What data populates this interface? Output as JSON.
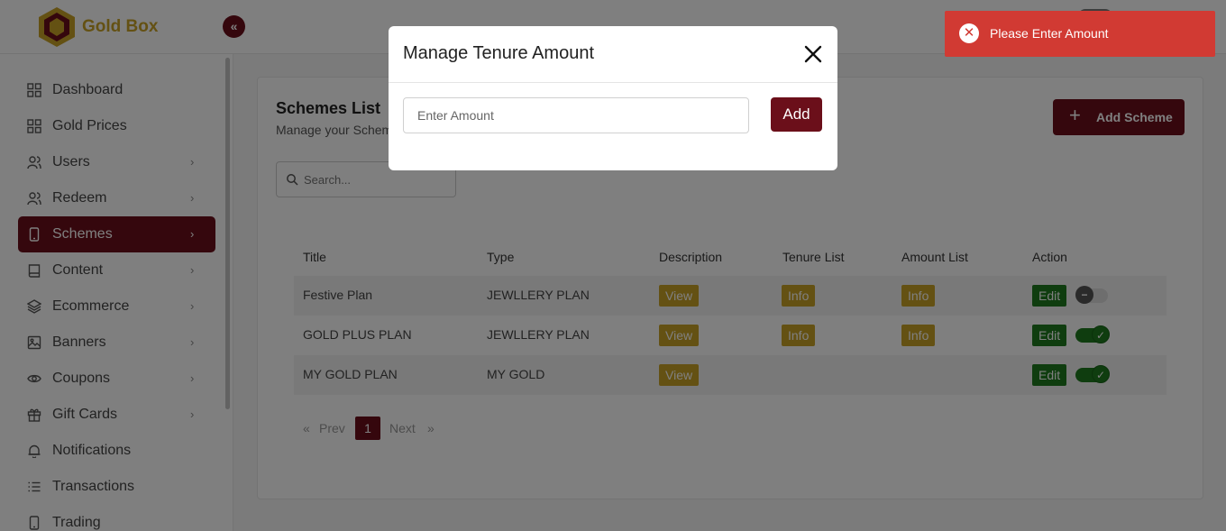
{
  "header": {
    "brand": "Gold Box",
    "collapse_icon": "«"
  },
  "sidebar": {
    "items": [
      {
        "label": "Dashboard",
        "icon": "grid-icon",
        "has_chevron": false
      },
      {
        "label": "Gold Prices",
        "icon": "grid-icon",
        "has_chevron": false
      },
      {
        "label": "Users",
        "icon": "users-icon",
        "has_chevron": true
      },
      {
        "label": "Redeem",
        "icon": "users-icon",
        "has_chevron": true
      },
      {
        "label": "Schemes",
        "icon": "phone-icon",
        "has_chevron": true,
        "active": true
      },
      {
        "label": "Content",
        "icon": "book-icon",
        "has_chevron": true
      },
      {
        "label": "Ecommerce",
        "icon": "layers-icon",
        "has_chevron": true
      },
      {
        "label": "Banners",
        "icon": "image-icon",
        "has_chevron": true
      },
      {
        "label": "Coupons",
        "icon": "eye-icon",
        "has_chevron": true
      },
      {
        "label": "Gift Cards",
        "icon": "gift-icon",
        "has_chevron": true
      },
      {
        "label": "Notifications",
        "icon": "bell-icon",
        "has_chevron": false
      },
      {
        "label": "Transactions",
        "icon": "list-icon",
        "has_chevron": false
      },
      {
        "label": "Trading",
        "icon": "phone-icon",
        "has_chevron": false
      }
    ],
    "chevron": "›"
  },
  "main": {
    "title": "Schemes List",
    "subtitle": "Manage your Schem",
    "add_button": "Add Scheme",
    "search_placeholder": "Search...",
    "columns": [
      "Title",
      "Type",
      "Description",
      "Tenure List",
      "Amount List",
      "Action"
    ],
    "rows": [
      {
        "title": "Festive Plan",
        "type": "JEWLLERY PLAN",
        "description": "View",
        "tenure": "Info",
        "amount": "Info",
        "edit": "Edit",
        "enabled": false
      },
      {
        "title": "GOLD PLUS PLAN",
        "type": "JEWLLERY PLAN",
        "description": "View",
        "tenure": "Info",
        "amount": "Info",
        "edit": "Edit",
        "enabled": true
      },
      {
        "title": "MY GOLD PLAN",
        "type": "MY GOLD",
        "description": "View",
        "tenure": "",
        "amount": "",
        "edit": "Edit",
        "enabled": true
      }
    ],
    "pagination": {
      "first": "«",
      "prev": "Prev",
      "current": "1",
      "next": "Next",
      "last": "»"
    }
  },
  "modal": {
    "title": "Manage Tenure Amount",
    "amount_placeholder": "Enter Amount",
    "add_button": "Add"
  },
  "toast": {
    "message": "Please Enter Amount",
    "type": "error"
  },
  "colors": {
    "maroon": "#6b0f1a",
    "gold": "#c9a227",
    "green": "#1f7a1f",
    "toast_red": "#d13a33"
  }
}
